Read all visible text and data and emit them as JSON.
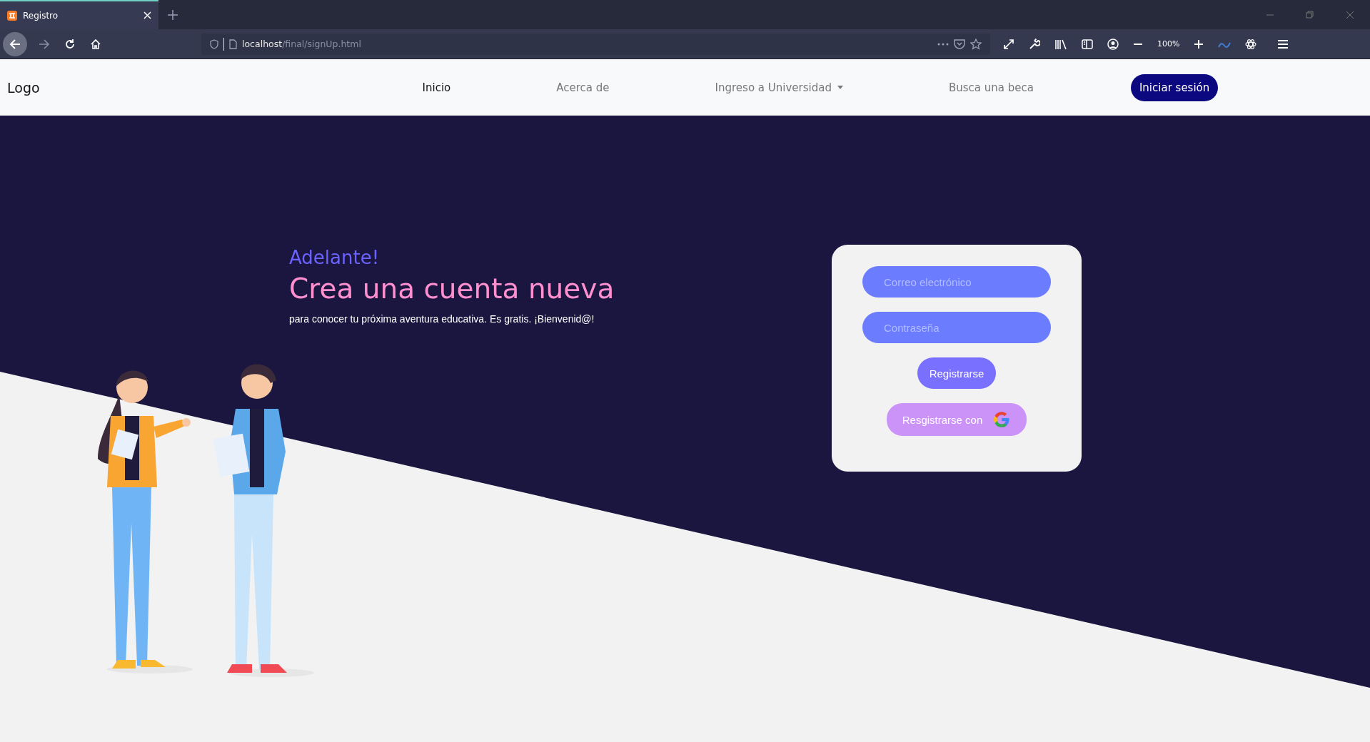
{
  "browser": {
    "tab": {
      "title": "Registro",
      "selected": true
    },
    "url": {
      "host": "localhost",
      "path": "/final/signUp.html"
    },
    "zoom": "100%"
  },
  "navbar": {
    "logo": "Logo",
    "links": [
      {
        "label": "Inicio",
        "kind": "link",
        "selected": true
      },
      {
        "label": "Acerca de",
        "kind": "link",
        "selected": false
      },
      {
        "label": "Ingreso a Universidad",
        "kind": "dropdown",
        "selected": false
      },
      {
        "label": "Busca una beca",
        "kind": "link",
        "selected": false
      }
    ],
    "login_button": "Iniciar sesión"
  },
  "hero": {
    "kicker": "Adelante!",
    "title": "Crea una cuenta nueva",
    "subtitle": "para conocer tu próxima aventura educativa. Es gratis. ¡Bienvenid@!"
  },
  "form": {
    "fields": [
      {
        "placeholder": "Correo electrónico"
      },
      {
        "placeholder": "Contraseña"
      }
    ],
    "submit": "Registrarse",
    "google_button": "Resgistrarse con"
  }
}
